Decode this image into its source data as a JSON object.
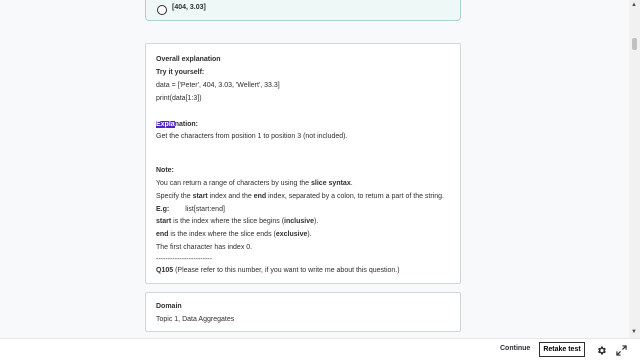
{
  "option": {
    "text": "[404, 3.03]"
  },
  "explanation": {
    "heading": "Overall explanation",
    "try_it": "Try it yourself:",
    "code_line1": "data = ['Peter', 404, 3.03, 'Wellert', 33.3]",
    "code_line2": "print(data[1:3])",
    "explanation_label_highlight": "Expla",
    "explanation_label_rest": "nation:",
    "explanation_text": "Get the characters from position 1 to position 3 (not included).",
    "note_label": "Note:",
    "note_line1_pre": "You can return a range of characters by using the ",
    "note_line1_bold": "slice syntax",
    "note_line1_post": ".",
    "note_line2_a": "Specify the ",
    "note_line2_b": "start",
    "note_line2_c": " index and the ",
    "note_line2_d": "end",
    "note_line2_e": " index, separated by a colon, to return a part of the string.",
    "eg_label": "E.g:",
    "eg_code": "list[start:end]",
    "start_word": "start",
    "start_text_pre": " is the index where the slice begins (",
    "start_text_bold": "inclusive",
    "start_text_post": ").",
    "end_word": "end",
    "end_text_pre": " is the index where the slice ends (",
    "end_text_bold": "exclusive",
    "end_text_post": ").",
    "first_char": "The first character has index 0.",
    "separator": "------------------------",
    "qid": "Q105",
    "qid_text": " (Please refer to this number, if you want to write me about this question.)"
  },
  "domain": {
    "label": "Domain",
    "value": "Topic 1, Data Aggregates"
  },
  "footer": {
    "continue_label": "Continue",
    "retake_label": "Retake test"
  },
  "icons": {
    "settings": "gear-icon",
    "expand": "expand-icon"
  }
}
